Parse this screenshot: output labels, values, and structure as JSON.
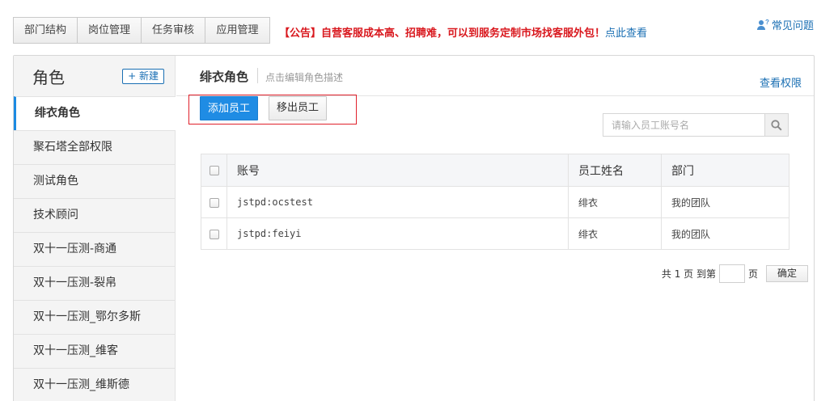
{
  "top_tabs": [
    "部门结构",
    "岗位管理",
    "任务审核",
    "应用管理"
  ],
  "notice": {
    "text": "【公告】自营客服成本高、招聘难，可以到服务定制市场找客服外包！",
    "link": "点此查看"
  },
  "faq_label": "常见问题",
  "sidebar": {
    "title": "角色",
    "new_button": "+ 新建",
    "roles": [
      "绯衣角色",
      "聚石塔全部权限",
      "测试角色",
      "技术顾问",
      "双十一压测-商通",
      "双十一压测-裂帛",
      "双十一压测_鄂尔多斯",
      "双十一压测_维客",
      "双十一压测_维斯德"
    ]
  },
  "content": {
    "role_name": "绯衣角色",
    "role_desc": "点击编辑角色描述",
    "view_permissions": "查看权限",
    "add_staff": "添加员工",
    "remove_staff": "移出员工",
    "search_placeholder": "请输入员工账号名"
  },
  "table": {
    "headers": [
      "账号",
      "员工姓名",
      "部门"
    ],
    "rows": [
      [
        "jstpd:ocstest",
        "绯衣",
        "我的团队"
      ],
      [
        "jstpd:feiyi",
        "绯衣",
        "我的团队"
      ]
    ]
  },
  "pager": {
    "prefix": "共 1 页 到第",
    "suffix": "页",
    "confirm": "确定"
  },
  "colors": {
    "accent": "#1f8ce4",
    "notice": "#d9181e",
    "link": "#1a6fb3",
    "highlight": "#e0212b"
  }
}
